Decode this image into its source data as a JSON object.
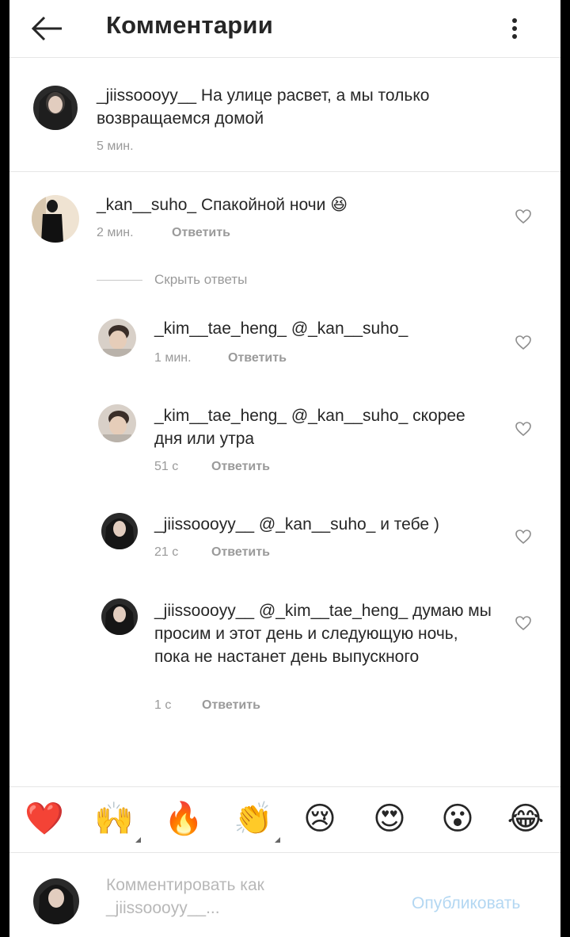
{
  "header": {
    "title": "Комментарии",
    "back_icon": "arrow-left-icon",
    "more_icon": "kebab-menu-icon"
  },
  "caption": {
    "username": "_jiissoooyy__",
    "text": "На улице расвет, а мы только возвращаемся домой",
    "time": "5 мин."
  },
  "comment": {
    "username": "_kan__suho_",
    "text": "Спакойной ночи",
    "emoji": "😆",
    "time": "2 мин.",
    "reply_label": "Ответить"
  },
  "hide_replies": "Скрыть ответы",
  "replies": [
    {
      "username": "_kim__tae_heng_",
      "mention": "@_kan__suho_",
      "text": "",
      "time": "1 мин.",
      "reply_label": "Ответить"
    },
    {
      "username": "_kim__tae_heng_",
      "mention": "@_kan__suho_",
      "text": "скорее дня или утра",
      "time": "51 с",
      "reply_label": "Ответить"
    },
    {
      "username": "_jiissoooyy__",
      "mention": "@_kan__suho_",
      "text": "и тебе )",
      "time": "21 с",
      "reply_label": "Ответить"
    },
    {
      "username": "_jiissoooyy__",
      "mention": "@_kim__tae_heng_",
      "text": "думаю мы просим и этот день и следующую ночь, пока не настанет день выпускного",
      "time": "1 с",
      "reply_label": "Ответить"
    }
  ],
  "emoji_bar": [
    "❤️",
    "🙌",
    "🔥",
    "👏",
    "😢",
    "😍",
    "😮",
    "😂"
  ],
  "composer": {
    "placeholder": "Комментировать как _jiissoooyy__...",
    "publish_label": "Опубликовать"
  },
  "colors": {
    "link": "#b3d7f2",
    "muted": "#9a9a9a",
    "heart": "#ed4956"
  }
}
